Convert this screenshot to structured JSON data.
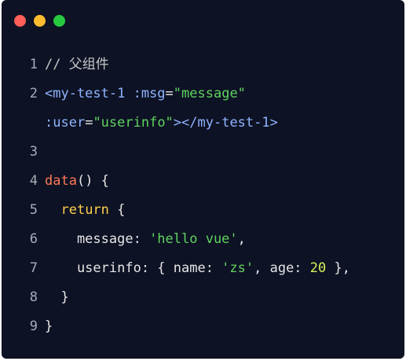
{
  "window": {
    "traffic_lights": [
      {
        "name": "close",
        "color": "#ff5f56"
      },
      {
        "name": "minimize",
        "color": "#ffbd2e"
      },
      {
        "name": "maximize",
        "color": "#27c93f"
      }
    ]
  },
  "colors": {
    "background": "#0d1224",
    "line_number": "#a9adb8",
    "comment": "#c8c8c8",
    "tag": "#8fb4ff",
    "attribute": "#8fb4ff",
    "string": "#5fd35f",
    "function": "#ff7a59",
    "keyword": "#ffcf4d",
    "number": "#d8f25a",
    "text": "#e6e6e6"
  },
  "code_lines": [
    {
      "number": "1",
      "tokens": [
        {
          "text": "// 父组件",
          "kind": "comment"
        }
      ]
    },
    {
      "number": "2",
      "tokens": [
        {
          "text": "<my-test-1",
          "kind": "tag"
        },
        {
          "text": " :msg",
          "kind": "attribute"
        },
        {
          "text": "=",
          "kind": "text"
        },
        {
          "text": "\"message\"",
          "kind": "string"
        }
      ]
    },
    {
      "number": "",
      "tokens": [
        {
          "text": ":user",
          "kind": "attribute"
        },
        {
          "text": "=",
          "kind": "text"
        },
        {
          "text": "\"userinfo\"",
          "kind": "string"
        },
        {
          "text": "></my-test-1>",
          "kind": "tag"
        }
      ]
    },
    {
      "number": "3",
      "tokens": []
    },
    {
      "number": "4",
      "tokens": [
        {
          "text": "data",
          "kind": "function"
        },
        {
          "text": "() {",
          "kind": "text"
        }
      ]
    },
    {
      "number": "5",
      "tokens": [
        {
          "text": "  ",
          "kind": "text"
        },
        {
          "text": "return",
          "kind": "keyword"
        },
        {
          "text": " {",
          "kind": "text"
        }
      ]
    },
    {
      "number": "6",
      "tokens": [
        {
          "text": "    message: ",
          "kind": "text"
        },
        {
          "text": "'hello vue'",
          "kind": "string"
        },
        {
          "text": ",",
          "kind": "text"
        }
      ]
    },
    {
      "number": "7",
      "tokens": [
        {
          "text": "    userinfo: { name: ",
          "kind": "text"
        },
        {
          "text": "'zs'",
          "kind": "string"
        },
        {
          "text": ", age: ",
          "kind": "text"
        },
        {
          "text": "20",
          "kind": "number"
        },
        {
          "text": " },",
          "kind": "text"
        }
      ]
    },
    {
      "number": "8",
      "tokens": [
        {
          "text": "  }",
          "kind": "text"
        }
      ]
    },
    {
      "number": "9",
      "tokens": [
        {
          "text": "}",
          "kind": "text"
        }
      ]
    }
  ]
}
